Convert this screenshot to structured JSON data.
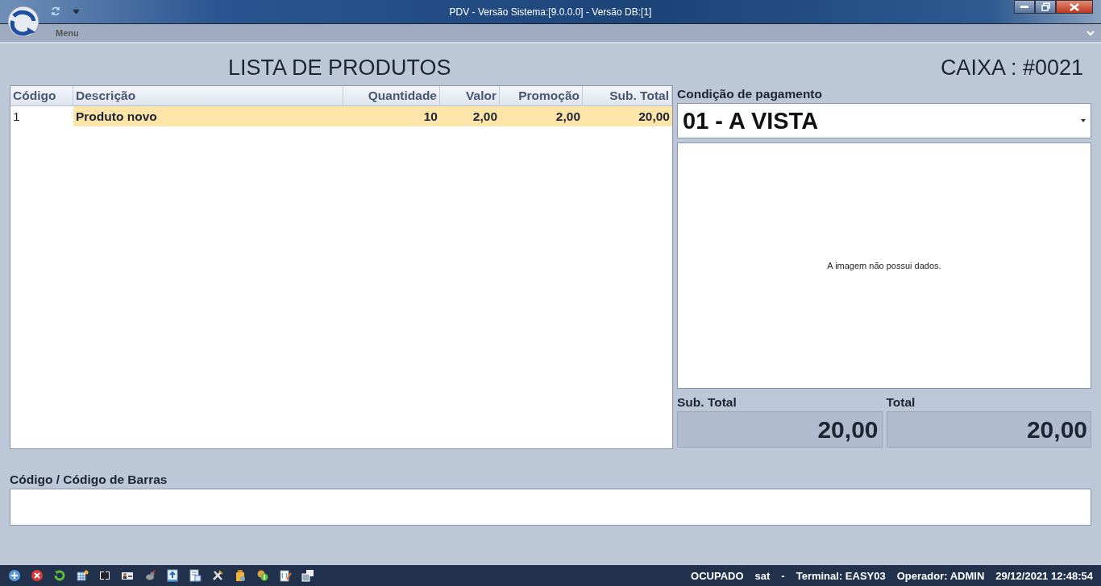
{
  "window": {
    "title": "PDV - Versão Sistema:[9.0.0.0] - Versão DB:[1]"
  },
  "menu": {
    "label": "Menu"
  },
  "heading": "LISTA DE PRODUTOS",
  "register": "CAIXA : #0021",
  "table": {
    "columns": [
      "Código",
      "Descrição",
      "Quantidade",
      "Valor",
      "Promoção",
      "Sub. Total"
    ],
    "rows": [
      {
        "selected": true,
        "cells": [
          "1",
          "Produto novo",
          "10",
          "2,00",
          "2,00",
          "20,00"
        ]
      }
    ]
  },
  "payment": {
    "label": "Condição de pagamento",
    "value": "01 - A VISTA"
  },
  "image_panel": {
    "message": "A imagem não possui dados."
  },
  "subtotal": {
    "label": "Sub. Total",
    "value": "20,00"
  },
  "total": {
    "label": "Total",
    "value": "20,00"
  },
  "barcode": {
    "label": "Código / Código de Barras"
  },
  "status_bar": {
    "items": [
      "OCUPADO",
      "sat",
      "-",
      "Terminal: EASY03",
      "Operador: ADMIN",
      "29/12/2021 12:48:54"
    ]
  }
}
